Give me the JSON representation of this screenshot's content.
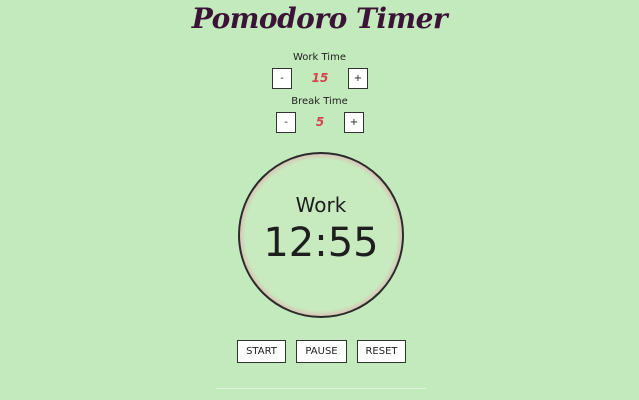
{
  "app": {
    "title": "Pomodoro Timer"
  },
  "work": {
    "label": "Work Time",
    "decrement": "-",
    "value": "15",
    "increment": "+"
  },
  "break": {
    "label": "Break Time",
    "decrement": "-",
    "value": "5",
    "increment": "+"
  },
  "timer": {
    "mode": "Work",
    "time": "12:55",
    "ring_color": "#e14d72"
  },
  "controls": {
    "start": "START",
    "pause": "PAUSE",
    "reset": "RESET"
  },
  "colors": {
    "background": "#c3eabd",
    "title": "#3a1336",
    "value": "#d8414e"
  }
}
